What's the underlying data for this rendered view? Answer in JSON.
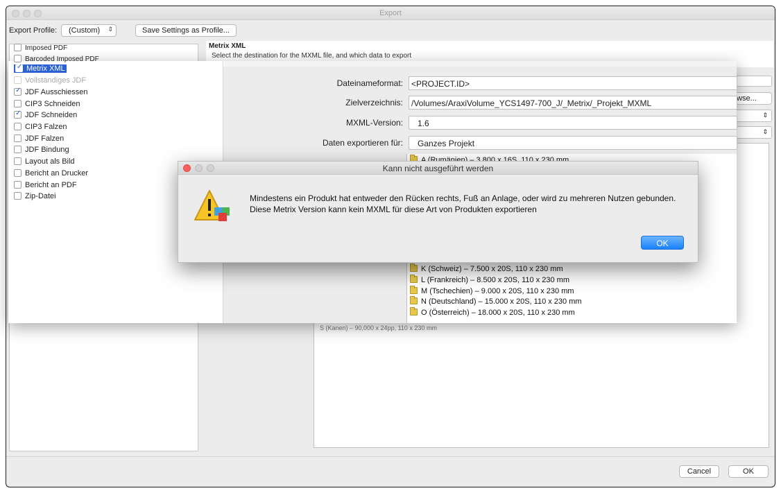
{
  "window": {
    "title": "Export"
  },
  "toolbar": {
    "profile_label": "Export Profile:",
    "profile_value": "(Custom)",
    "save_button": "Save Settings as Profile..."
  },
  "main": {
    "title": "Metrix XML",
    "subtitle": "Select the destination for the MXML file, and which data to export",
    "browse_label": "owse...",
    "ghost_row": "S (Kanen) – 90,000 x 24pp, 110 x 230 mm"
  },
  "export_types": [
    {
      "label": "Imposed PDF",
      "checked": false
    },
    {
      "label": "Barcoded Imposed PDF",
      "checked": false
    },
    {
      "label": "Metrix XML",
      "checked": true,
      "selected": true
    },
    {
      "label": "Vollständiges JDF",
      "checked": false,
      "disabled": true
    },
    {
      "label": "JDF Ausschiessen",
      "checked": true
    },
    {
      "label": "CIP3 Schneiden",
      "checked": false
    },
    {
      "label": "JDF Schneiden",
      "checked": true
    },
    {
      "label": "CIP3 Falzen",
      "checked": false
    },
    {
      "label": "JDF Falzen",
      "checked": false
    },
    {
      "label": "JDF Bindung",
      "checked": false
    },
    {
      "label": "Layout als Bild",
      "checked": false
    },
    {
      "label": "Bericht an Drucker",
      "checked": false
    },
    {
      "label": "Bericht an PDF",
      "checked": false
    },
    {
      "label": "Zip-Datei",
      "checked": false
    }
  ],
  "form": {
    "filename_label": "Dateinameformat:",
    "filename_value": "<PROJECT.ID>",
    "dir_label": "Zielverzeichnis:",
    "dir_value": "/Volumes/AraxiVolume_YCS1497-700_J/_Metrix/_Projekt_MXML",
    "version_label": "MXML-Version:",
    "version_value": "1.6",
    "export_label": "Daten exportieren für:",
    "export_value": "Ganzes Projekt"
  },
  "products": [
    "A (Rumänien) – 3.800 x 16S, 110 x 230 mm",
    "K (Schweiz) – 7.500 x 20S, 110 x 230 mm",
    "L (Frankreich) – 8.500 x 20S, 110 x 230 mm",
    "M (Tschechien) – 9.000 x 20S, 110 x 230 mm",
    "N (Deutschland) – 15.000 x 20S, 110 x 230 mm",
    "O (Österreich) – 18.000 x 20S, 110 x 230 mm"
  ],
  "dialog": {
    "title": "Kann nicht ausgeführt werden",
    "message_line1": "Mindestens ein Produkt hat entweder den Rücken rechts, Fuß an Anlage, oder wird zu mehreren Nutzen gebunden.",
    "message_line2": "Diese Metrix Version kann kein MXML für diese Art von Produkten exportieren",
    "ok_label": "OK"
  },
  "footer": {
    "cancel_label": "Cancel",
    "ok_label": "OK"
  },
  "colors": {
    "selection": "#2a62d6",
    "dialog_ok": "#1a82fb",
    "close_dot": "#fc605c"
  },
  "icons": {
    "warning": "warning-icon",
    "folder": "folder-icon"
  }
}
